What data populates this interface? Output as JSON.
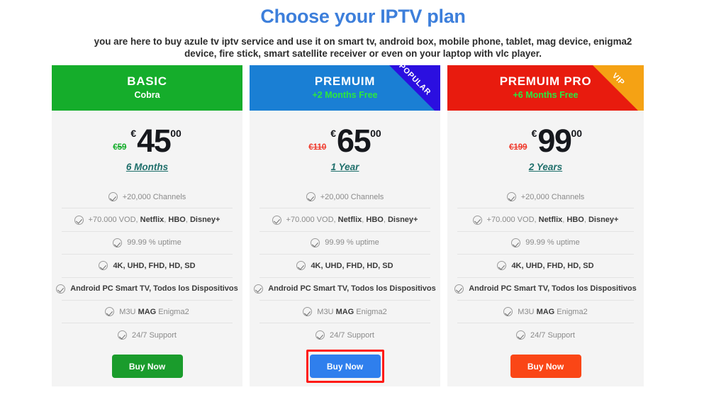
{
  "header": {
    "title": "Choose your IPTV plan",
    "subtitle": "you are here to buy azule tv iptv service and use it on smart tv, android box, mobile phone, tablet, mag device, enigma2 device, fire stick, smart satellite receiver or even on your laptop with vlc player.",
    "title_color": "#3d7fdb"
  },
  "features_common": [
    {
      "text": "+20,000 Channels",
      "bold_parts": [],
      "all_bold": false
    },
    {
      "text": "+70.000 VOD, Netflix, HBO, Disney+",
      "bold_parts": [
        "Netflix",
        "HBO",
        "Disney+"
      ],
      "all_bold": false
    },
    {
      "text": "99.99 % uptime",
      "bold_parts": [],
      "all_bold": false
    },
    {
      "text": "4K, UHD, FHD, HD, SD",
      "bold_parts": [],
      "all_bold": true
    },
    {
      "text": "Android PC Smart TV, Todos los Dispositivos",
      "bold_parts": [],
      "all_bold": true
    },
    {
      "text": "M3U MAG Enigma2",
      "bold_parts": [
        "MAG"
      ],
      "all_bold": false
    },
    {
      "text": "24/7 Support",
      "bold_parts": [],
      "all_bold": false
    }
  ],
  "plans": [
    {
      "name": "BASIC",
      "subtitle": "Cobra",
      "header_color": "#15ad2b",
      "subtitle_color": "#ffffff",
      "old_price": "€59",
      "old_price_color": "#15ad2b",
      "currency": "€",
      "amount": "45",
      "cents": "00",
      "period": "6 Months",
      "ribbon": null,
      "button_label": "Buy Now",
      "button_color": "#1a9c2c",
      "focused": false
    },
    {
      "name": "PREMUIM",
      "subtitle": "+2 Months Free",
      "header_color": "#1a7fd4",
      "subtitle_color": "#2be840",
      "old_price": "€110",
      "old_price_color": "#f0392b",
      "currency": "€",
      "amount": "65",
      "cents": "00",
      "period": "1 Year",
      "ribbon": {
        "label": "POPULAR",
        "color": "#2b0fe0"
      },
      "button_label": "Buy Now",
      "button_color": "#2f7fed",
      "focused": true
    },
    {
      "name": "PREMUIM PRO",
      "subtitle": "+6 Months Free",
      "header_color": "#e81b0e",
      "subtitle_color": "#2be840",
      "old_price": "€199",
      "old_price_color": "#f0392b",
      "currency": "€",
      "amount": "99",
      "cents": "00",
      "period": "2 Years",
      "ribbon": {
        "label": "VIP",
        "color": "#f5a214"
      },
      "button_label": "Buy Now",
      "button_color": "#fa4616",
      "focused": false
    }
  ]
}
